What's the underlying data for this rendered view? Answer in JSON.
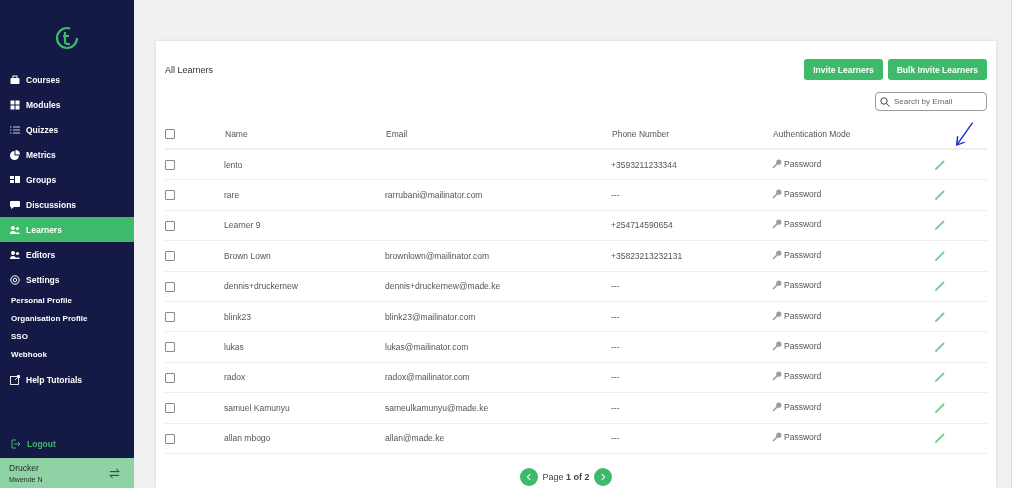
{
  "sidebar": {
    "items": [
      {
        "label": "Courses",
        "kind": "nav",
        "selected": false
      },
      {
        "label": "Modules",
        "kind": "nav",
        "selected": false
      },
      {
        "label": "Quizzes",
        "kind": "nav",
        "selected": false
      },
      {
        "label": "Metrics",
        "kind": "nav",
        "selected": false
      },
      {
        "label": "Groups",
        "kind": "nav",
        "selected": false
      },
      {
        "label": "Discussions",
        "kind": "nav",
        "selected": false
      },
      {
        "label": "Learners",
        "kind": "nav",
        "selected": true
      },
      {
        "label": "Editors",
        "kind": "nav",
        "selected": false
      },
      {
        "label": "Settings",
        "kind": "nav",
        "selected": false
      },
      {
        "label": "Personal Profile",
        "kind": "sub",
        "selected": false
      },
      {
        "label": "Organisation Profile",
        "kind": "sub",
        "selected": false
      },
      {
        "label": "SSO",
        "kind": "sub",
        "selected": false
      },
      {
        "label": "Webhook",
        "kind": "sub",
        "selected": false
      },
      {
        "label": "Help Tutorials",
        "kind": "nav",
        "selected": false
      }
    ],
    "logout": "Logout",
    "account": {
      "organisation": "Drucker",
      "user": "Mwende N"
    }
  },
  "card": {
    "title": "All Learners",
    "buttons": [
      "Invite Learners",
      "Bulk Invite Learners"
    ],
    "search": {
      "placeholder": "Search by Email"
    }
  },
  "table": {
    "columns": [
      "Name",
      "Email",
      "Phone Number",
      "Authentication Mode"
    ],
    "header_checked": false,
    "rows": [
      {
        "checked": false,
        "name": "lento",
        "email": "",
        "phone": "+3593211233344",
        "auth": "Password"
      },
      {
        "checked": false,
        "name": "rare",
        "email": "rarrubani@mailinator.com",
        "phone": "---",
        "auth": "Password"
      },
      {
        "checked": false,
        "name": "Learner 9",
        "email": "",
        "phone": "+254714590654",
        "auth": "Password"
      },
      {
        "checked": false,
        "name": "Brown Lown",
        "email": "brownlown@mailinator.com",
        "phone": "+35823213232131",
        "auth": "Password"
      },
      {
        "checked": false,
        "name": "dennis+druckernew",
        "email": "dennis+druckernew@made.ke",
        "phone": "---",
        "auth": "Password"
      },
      {
        "checked": false,
        "name": "blink23",
        "email": "blink23@mailinator.com",
        "phone": "---",
        "auth": "Password"
      },
      {
        "checked": false,
        "name": "lukas",
        "email": "lukas@mailinator.com",
        "phone": "---",
        "auth": "Password"
      },
      {
        "checked": false,
        "name": "radox",
        "email": "radox@mailinator.com",
        "phone": "---",
        "auth": "Password"
      },
      {
        "checked": false,
        "name": "samuel Kamunyu",
        "email": "sameulkamunyu@made.ke",
        "phone": "---",
        "auth": "Password"
      },
      {
        "checked": false,
        "name": "allan mbogo",
        "email": "allan@made.ke",
        "phone": "---",
        "auth": "Password"
      }
    ]
  },
  "pagination": {
    "label": "Page **1 of 2**"
  }
}
